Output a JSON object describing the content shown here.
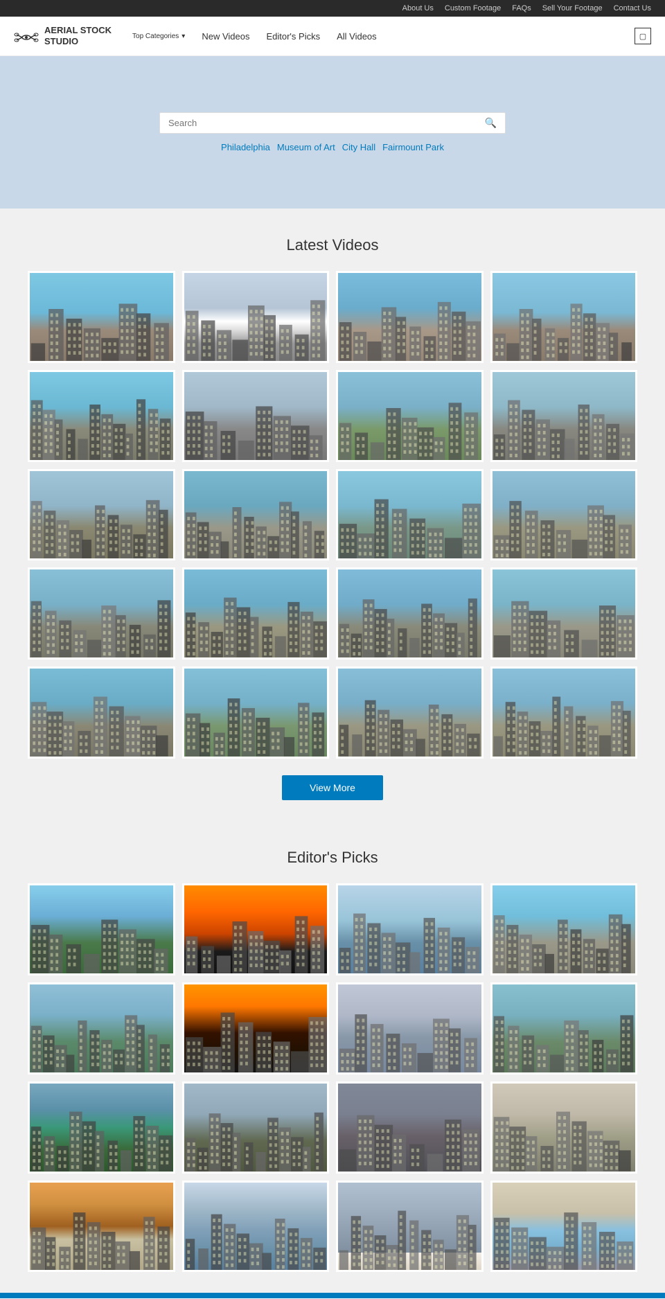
{
  "topbar": {
    "links": [
      "About Us",
      "Custom Footage",
      "FAQs",
      "Sell Your Footage",
      "Contact Us"
    ]
  },
  "header": {
    "logo_line1": "AERIAL STOCK",
    "logo_line2": "STUDIO",
    "nav": [
      {
        "label": "Top Categories",
        "hasDropdown": true
      },
      {
        "label": "New Videos"
      },
      {
        "label": "Editor's Picks"
      },
      {
        "label": "All Videos"
      }
    ],
    "cart_icon": "🛒"
  },
  "hero": {
    "search_placeholder": "Search",
    "tags": [
      "Philadelphia",
      "Museum of Art",
      "City Hall",
      "Fairmount Park"
    ]
  },
  "latest_videos": {
    "title": "Latest Videos",
    "thumbClasses": [
      "t1",
      "t2",
      "t3",
      "t4",
      "t5",
      "t6",
      "t7",
      "t8",
      "t9",
      "t10",
      "t11",
      "t12",
      "t13",
      "t14",
      "t15",
      "t16",
      "t17",
      "t18",
      "t19",
      "t20"
    ],
    "view_more": "View More"
  },
  "editors_picks": {
    "title": "Editor's Picks",
    "thumbClasses": [
      "ep1",
      "ep2",
      "ep3",
      "ep4",
      "ep5",
      "ep6",
      "ep7",
      "ep8",
      "ep9",
      "ep10",
      "ep11",
      "ep12",
      "ep13",
      "ep14",
      "ep15",
      "ep16"
    ]
  }
}
